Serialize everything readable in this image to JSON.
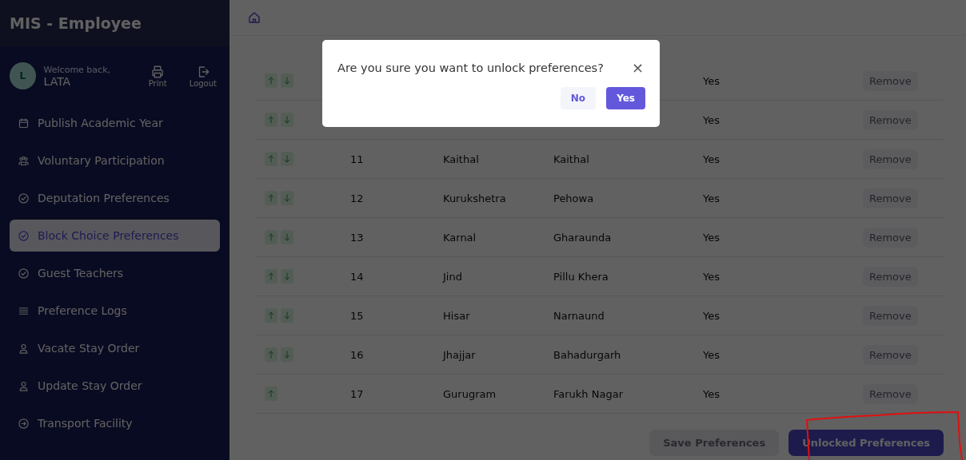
{
  "sidebar": {
    "title": "MIS - Employee",
    "profile": {
      "initial": "L",
      "greeting": "Welcome back,",
      "name": "LATA",
      "actions": [
        {
          "label": "Print"
        },
        {
          "label": "Logout"
        }
      ]
    },
    "items": [
      {
        "label": "Publish Academic Year",
        "selected": false
      },
      {
        "label": "Voluntary Participation",
        "selected": false
      },
      {
        "label": "Deputation Preferences",
        "selected": false
      },
      {
        "label": "Block Choice Preferences",
        "selected": true
      },
      {
        "label": "Guest Teachers",
        "selected": false
      },
      {
        "label": "Preference Logs",
        "selected": false
      },
      {
        "label": "Vacate Stay Order",
        "selected": false
      },
      {
        "label": "Update Stay Order",
        "selected": false
      },
      {
        "label": "Transport Facility",
        "selected": false
      }
    ]
  },
  "table": {
    "rows": [
      {
        "number": "",
        "district": "",
        "block": "",
        "status": "Yes",
        "action": "Remove",
        "can_move_down": true
      },
      {
        "number": "",
        "district": "",
        "block": "",
        "status": "Yes",
        "action": "Remove",
        "can_move_down": true
      },
      {
        "number": "11",
        "district": "Kaithal",
        "block": "Kaithal",
        "status": "Yes",
        "action": "Remove",
        "can_move_down": true
      },
      {
        "number": "12",
        "district": "Kurukshetra",
        "block": "Pehowa",
        "status": "Yes",
        "action": "Remove",
        "can_move_down": true
      },
      {
        "number": "13",
        "district": "Karnal",
        "block": "Gharaunda",
        "status": "Yes",
        "action": "Remove",
        "can_move_down": true
      },
      {
        "number": "14",
        "district": "Jind",
        "block": "Pillu Khera",
        "status": "Yes",
        "action": "Remove",
        "can_move_down": true
      },
      {
        "number": "15",
        "district": "Hisar",
        "block": "Narnaund",
        "status": "Yes",
        "action": "Remove",
        "can_move_down": true
      },
      {
        "number": "16",
        "district": "Jhajjar",
        "block": "Bahadurgarh",
        "status": "Yes",
        "action": "Remove",
        "can_move_down": true
      },
      {
        "number": "17",
        "district": "Gurugram",
        "block": "Farukh Nagar",
        "status": "Yes",
        "action": "Remove",
        "can_move_down": false
      }
    ]
  },
  "buttons": [
    {
      "label": "Save Preferences",
      "kind": "secondary"
    },
    {
      "label": "Unlocked Preferences",
      "kind": "primary"
    }
  ],
  "dialog": {
    "message": "Are you sure you want to unlock preferences?",
    "close": "×",
    "buttons": [
      {
        "label": "No",
        "kind": "secondary"
      },
      {
        "label": "Yes",
        "kind": "primary"
      }
    ]
  }
}
